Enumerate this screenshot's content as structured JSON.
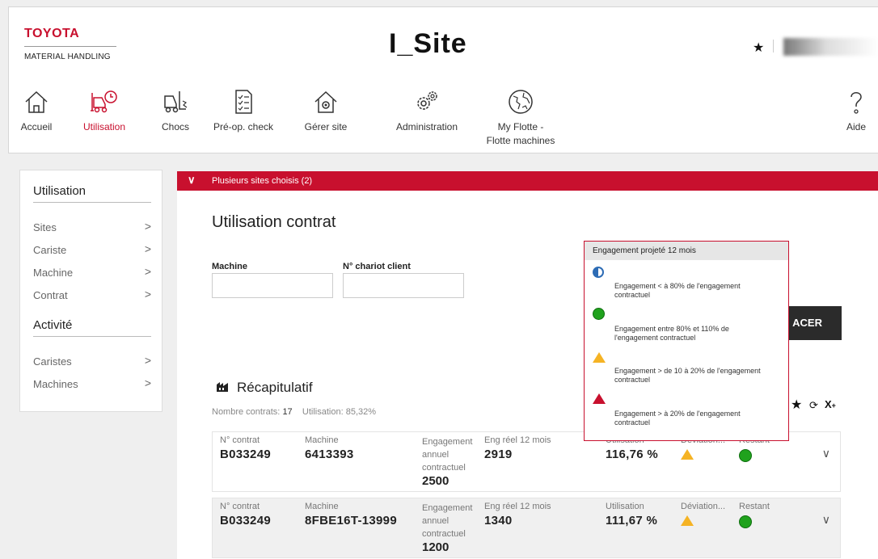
{
  "header": {
    "brand": "TOYOTA",
    "brand_sub": "MATERIAL HANDLING",
    "site_title": "I_Site"
  },
  "nav": {
    "items": [
      {
        "label": "Accueil",
        "icon": "home-icon"
      },
      {
        "label": "Utilisation",
        "icon": "forklift-clock-icon",
        "active": true
      },
      {
        "label": "Chocs",
        "icon": "forklift-impact-icon"
      },
      {
        "label": "Pré-op. check",
        "icon": "checklist-icon"
      },
      {
        "label": "Gérer site",
        "icon": "house-gear-icon"
      },
      {
        "label": "Administration",
        "icon": "gears-icon"
      },
      {
        "label": "My Flotte -",
        "label2": "Flotte machines",
        "icon": "globe-icon"
      },
      {
        "label": "Aide",
        "icon": "question-icon"
      }
    ],
    "active_color": "#c8102e"
  },
  "sidebar": {
    "section1": "Utilisation",
    "items1": [
      "Sites",
      "Cariste",
      "Machine",
      "Contrat"
    ],
    "section2": "Activité",
    "items2": [
      "Caristes",
      "Machines"
    ]
  },
  "filter_bar": {
    "label": "Plusieurs sites choisis (2)",
    "color": "#c8102e"
  },
  "main": {
    "title": "Utilisation contrat",
    "machine_label": "Machine",
    "machine_value": "",
    "chariot_label": "N° chariot client",
    "chariot_value": "",
    "apply_label": "ACER"
  },
  "recap": {
    "title": "Récapitulatif",
    "contracts_label": "Nombre contrats:",
    "contracts_value": "17",
    "utilisation_label": "Utilisation:",
    "utilisation_value": "85,32%"
  },
  "legend": {
    "title": "Engagement projeté 12 mois",
    "entries": [
      {
        "icon": "half-circle-icon",
        "text1": "Engagement < à 80% de l'engagement",
        "text2": "contractuel"
      },
      {
        "icon": "green-dot-icon",
        "text1": "Engagement entre 80% et 110% de",
        "text2": "l'engagement contractuel"
      },
      {
        "icon": "warning-triangle-icon",
        "text1": "Engagement > de 10 à 20% de l'engagement",
        "text2": "contractuel"
      },
      {
        "icon": "red-triangle-icon",
        "text1": "Engagement > à 20% de l'engagement",
        "text2": "contractuel"
      }
    ]
  },
  "table": {
    "labels": {
      "contrat": "N° contrat",
      "machine": "Machine",
      "engagement1": "Engagement",
      "engagement2": "annuel",
      "engagement3": "contractuel",
      "eng_reel": "Eng réel 12 mois",
      "utilisation": "Utilisation",
      "deviation": "Déviation...",
      "restant": "Restant"
    },
    "rows": [
      {
        "contrat": "B033249",
        "machine": "6413393",
        "engagement": "2500",
        "eng_reel": "2919",
        "utilisation": "116,76 %",
        "deviation": "warning",
        "restant": "green"
      },
      {
        "contrat": "B033249",
        "machine": "8FBE16T-13999",
        "engagement": "1200",
        "eng_reel": "1340",
        "utilisation": "111,67 %",
        "deviation": "warning",
        "restant": "green"
      }
    ]
  }
}
